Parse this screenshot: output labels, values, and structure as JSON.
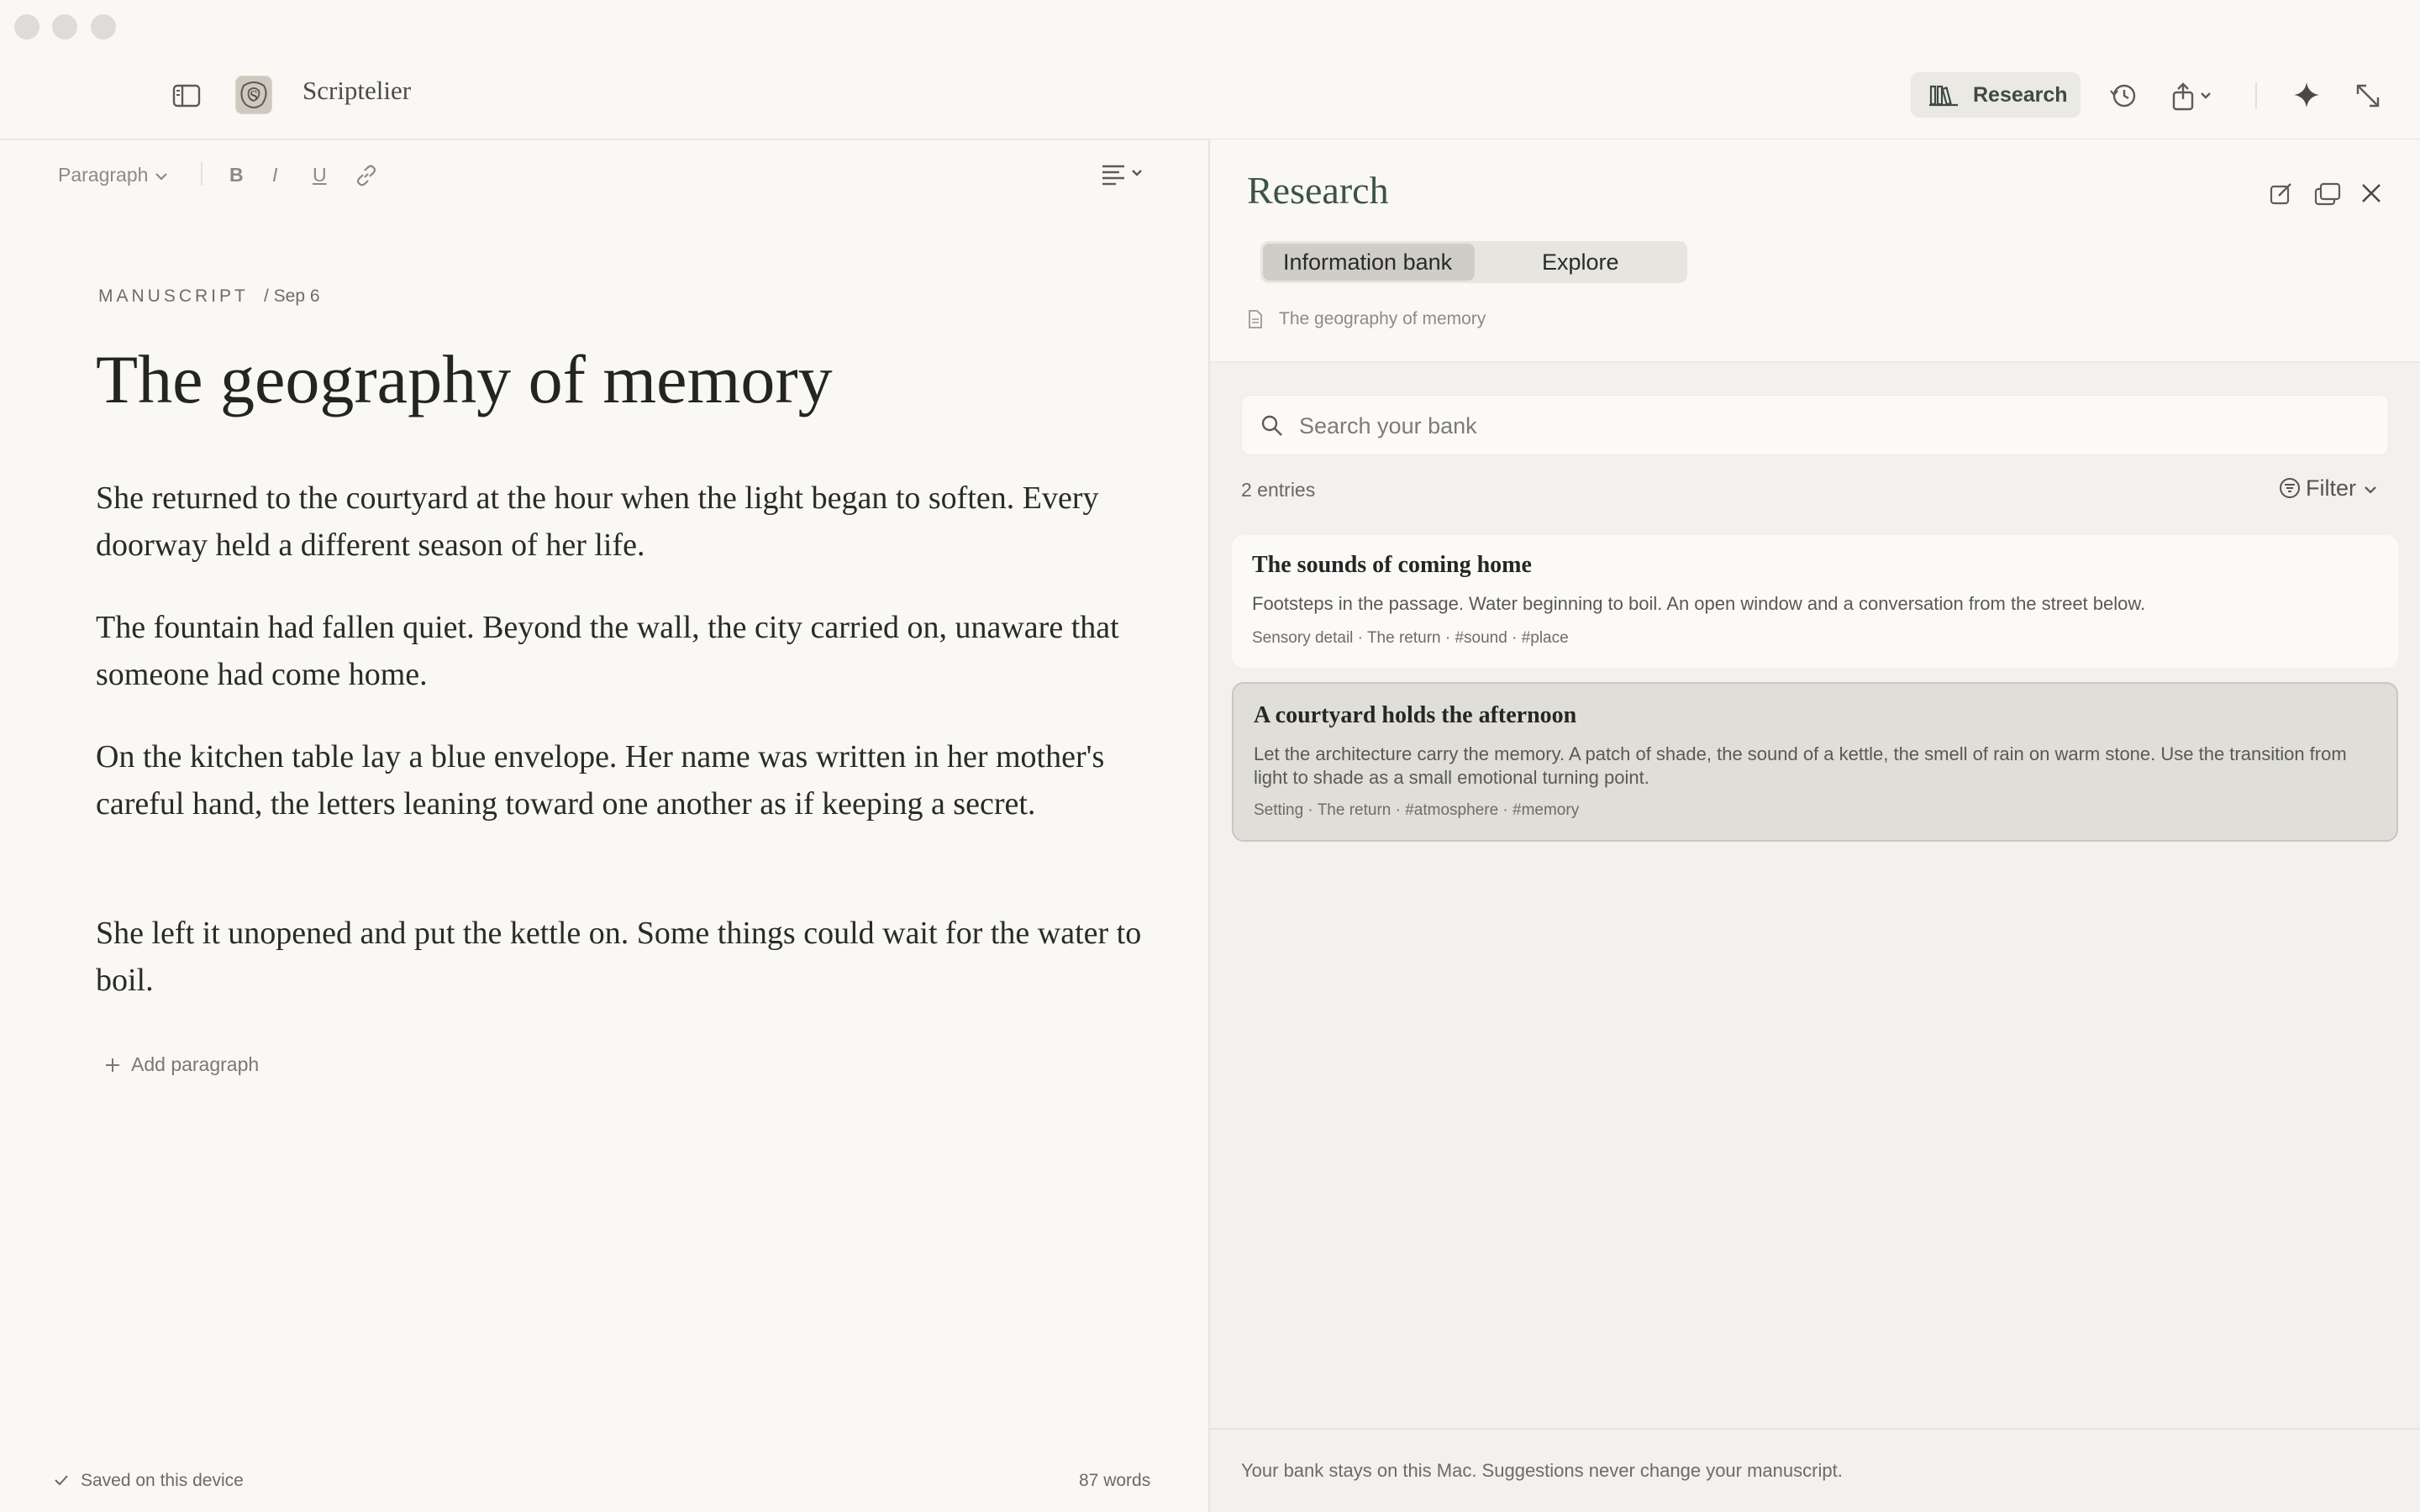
{
  "app": {
    "name": "Scriptelier"
  },
  "header": {
    "research_label": "Research"
  },
  "toolbar": {
    "style_select": "Paragraph",
    "bold": "B",
    "italic": "I",
    "underline": "U"
  },
  "document": {
    "section": "MANUSCRIPT",
    "date": "/ Sep 6",
    "title": "The geography of memory",
    "paragraphs": [
      "She returned to the courtyard at the hour when the light began to soften. Every doorway held a different season of her life.",
      "The fountain had fallen quiet. Beyond the wall, the city carried on, unaware that someone had come home.",
      "On the kitchen table lay a blue envelope. Her name was written in her mother's careful hand, the letters leaning toward one another as if keeping a secret.",
      "She left it unopened and put the kettle on. Some things could wait for the water to boil."
    ],
    "add_paragraph": "Add paragraph"
  },
  "footer": {
    "saved_status": "Saved on this device",
    "word_count": "87 words"
  },
  "research": {
    "title": "Research",
    "tabs": [
      "Information bank",
      "Explore"
    ],
    "active_tab": "Information bank",
    "context_doc": "The geography of memory",
    "search_placeholder": "Search your bank",
    "entry_count": "2 entries",
    "filter_label": "Filter",
    "entries": [
      {
        "title": "The sounds of coming home",
        "body": "Footsteps in the passage. Water beginning to boil. An open window and a conversation from the street below.",
        "meta": "Sensory detail · The return · #sound · #place"
      },
      {
        "title": "A courtyard holds the afternoon",
        "body": "Let the architecture carry the memory. A patch of shade, the sound of a kettle, the smell of rain on warm stone.  Use the transition from light to shade as a small emotional turning point.",
        "meta": "Setting · The return · #atmosphere · #memory"
      }
    ],
    "footer_note": "Your bank stays on this Mac. Suggestions never change your manuscript."
  },
  "colors": {
    "background": "#f9f8f5",
    "panel": "#f2f1ed",
    "accent_green": "#3d5347",
    "selected_card": "#dfded8"
  }
}
